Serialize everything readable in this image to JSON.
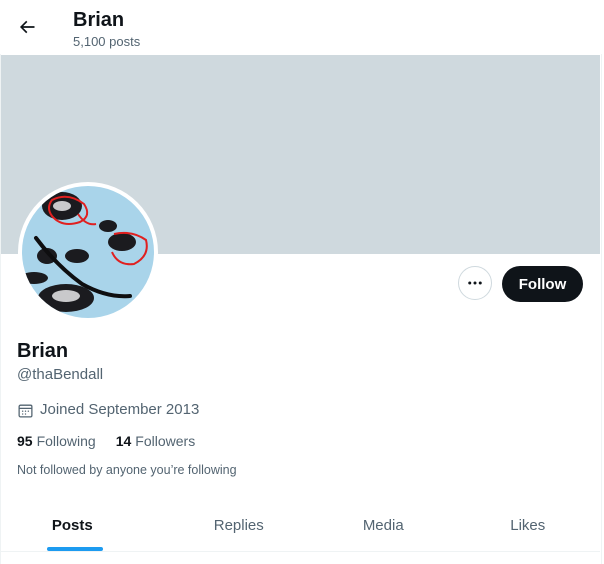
{
  "header": {
    "name": "Brian",
    "posts_count": "5,100 posts"
  },
  "profile": {
    "name": "Brian",
    "handle": "@thaBendall",
    "joined": "Joined September 2013",
    "following_count": "95",
    "following_label": "Following",
    "followers_count": "14",
    "followers_label": "Followers",
    "follow_note": "Not followed by anyone you’re following"
  },
  "actions": {
    "follow_label": "Follow",
    "more_icon": "more-horizontal-icon"
  },
  "tabs": [
    {
      "label": "Posts",
      "active": true
    },
    {
      "label": "Replies",
      "active": false
    },
    {
      "label": "Media",
      "active": false
    },
    {
      "label": "Likes",
      "active": false
    }
  ],
  "colors": {
    "banner": "#cfd9de",
    "accent": "#1d9bf0",
    "follow_button": "#0f1419",
    "muted_text": "#536471"
  }
}
